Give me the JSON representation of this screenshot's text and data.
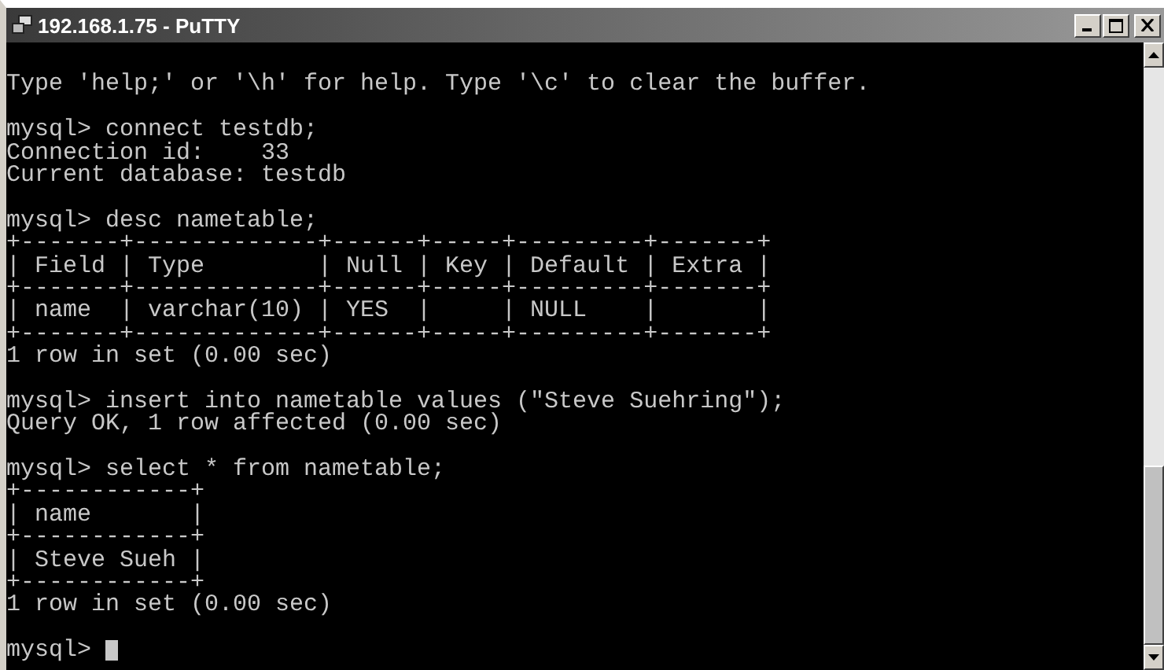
{
  "window": {
    "title": "192.168.1.75 - PuTTY"
  },
  "terminal": {
    "lines": [
      {
        "kind": "blank"
      },
      {
        "kind": "text",
        "text": "Type 'help;' or '\\h' for help. Type '\\c' to clear the buffer."
      },
      {
        "kind": "blank"
      },
      {
        "kind": "text",
        "text": "mysql> connect testdb;"
      },
      {
        "kind": "text",
        "text": "Connection id:    33"
      },
      {
        "kind": "text",
        "text": "Current database: testdb"
      },
      {
        "kind": "blank"
      },
      {
        "kind": "text",
        "text": "mysql> desc nametable;"
      },
      {
        "kind": "text",
        "text": "+-------+-------------+------+-----+---------+-------+"
      },
      {
        "kind": "text",
        "text": "| Field | Type        | Null | Key | Default | Extra |"
      },
      {
        "kind": "text",
        "text": "+-------+-------------+------+-----+---------+-------+"
      },
      {
        "kind": "text",
        "text": "| name  | varchar(10) | YES  |     | NULL    |       |"
      },
      {
        "kind": "text",
        "text": "+-------+-------------+------+-----+---------+-------+"
      },
      {
        "kind": "text",
        "text": "1 row in set (0.00 sec)"
      },
      {
        "kind": "blank"
      },
      {
        "kind": "text",
        "text": "mysql> insert into nametable values (\"Steve Suehring\");"
      },
      {
        "kind": "text",
        "text": "Query OK, 1 row affected (0.00 sec)"
      },
      {
        "kind": "blank"
      },
      {
        "kind": "text",
        "text": "mysql> select * from nametable;"
      },
      {
        "kind": "text",
        "text": "+------------+"
      },
      {
        "kind": "text",
        "text": "| name       |"
      },
      {
        "kind": "text",
        "text": "+------------+"
      },
      {
        "kind": "text",
        "text": "| Steve Sueh |"
      },
      {
        "kind": "text",
        "text": "+------------+"
      },
      {
        "kind": "text",
        "text": "1 row in set (0.00 sec)"
      },
      {
        "kind": "blank"
      },
      {
        "kind": "prompt",
        "text": "mysql>"
      }
    ]
  }
}
